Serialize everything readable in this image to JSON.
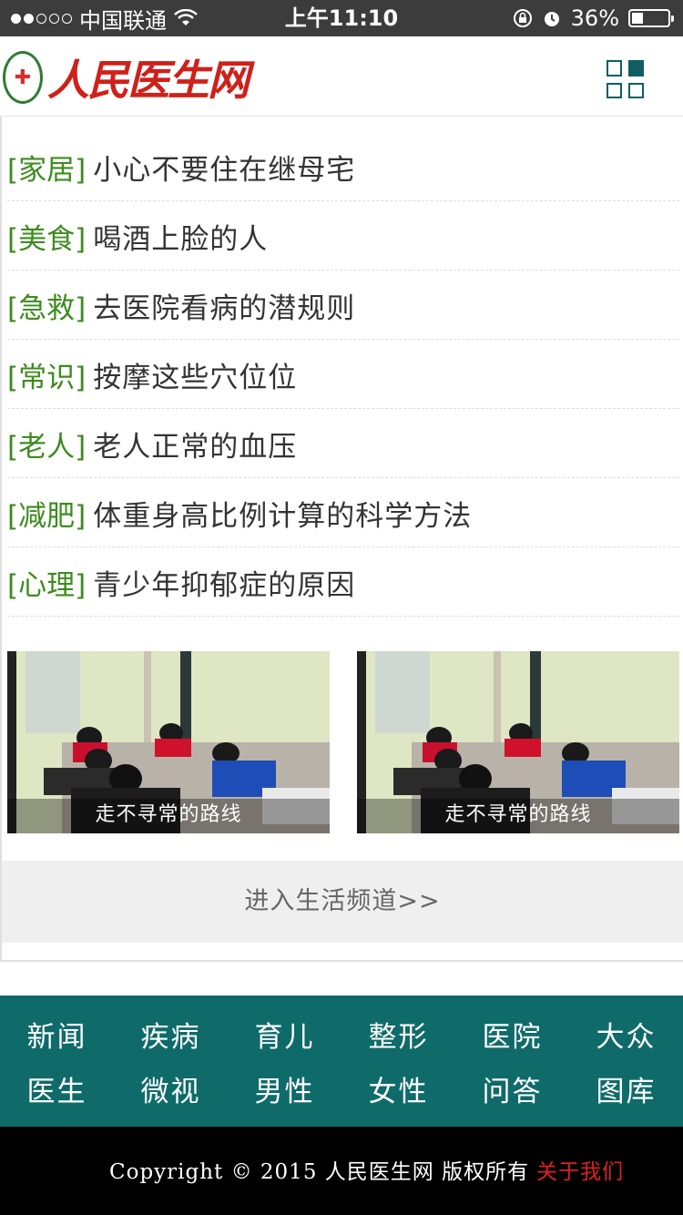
{
  "status_bar": {
    "carrier": "中国联通",
    "time": "上午11:10",
    "battery": "36%",
    "battery_level": 0.36
  },
  "header": {
    "site_name": "人民医生网",
    "menu_icon": "grid-menu-icon"
  },
  "news": [
    {
      "tag": "[家居]",
      "title": "小心不要住在继母宅"
    },
    {
      "tag": "[美食]",
      "title": "喝酒上脸的人"
    },
    {
      "tag": "[急救]",
      "title": "去医院看病的潜规则"
    },
    {
      "tag": "[常识]",
      "title": "按摩这些穴位位"
    },
    {
      "tag": "[老人]",
      "title": "老人正常的血压"
    },
    {
      "tag": "[减肥]",
      "title": "体重身高比例计算的科学方法"
    },
    {
      "tag": "[心理]",
      "title": "青少年抑郁症的原因"
    }
  ],
  "pictures": [
    {
      "caption": "走不寻常的路线"
    },
    {
      "caption": "走不寻常的路线"
    }
  ],
  "more_link": "进入生活频道>>",
  "nav": [
    "新闻",
    "疾病",
    "育儿",
    "整形",
    "医院",
    "大众",
    "医生",
    "微视",
    "男性",
    "女性",
    "问答",
    "图库"
  ],
  "footer": {
    "copyright": "Copyright © 2015 人民医生网 版权所有",
    "about": "关于我们"
  },
  "colors": {
    "tag_green": "#3d8b1e",
    "nav_teal": "#0f6b6a",
    "logo_red": "#d0201a",
    "about_red": "#e02020"
  }
}
